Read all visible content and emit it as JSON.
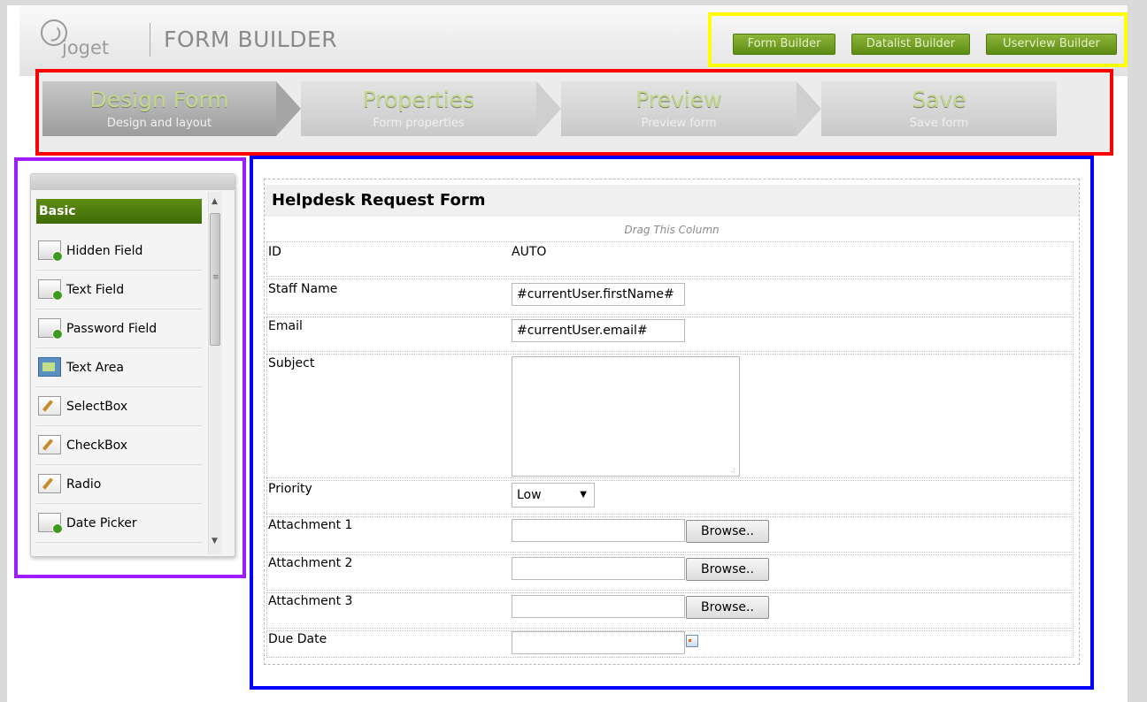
{
  "header": {
    "logo_text": "joget",
    "app_title": "FORM BUILDER",
    "nav": [
      {
        "label": "Form Builder"
      },
      {
        "label": "Datalist Builder"
      },
      {
        "label": "Userview Builder"
      }
    ]
  },
  "wizard": {
    "steps": [
      {
        "label": "Design Form",
        "sub": "Design and layout",
        "active": true
      },
      {
        "label": "Properties",
        "sub": "Form properties",
        "active": false
      },
      {
        "label": "Preview",
        "sub": "Preview form",
        "active": false
      },
      {
        "label": "Save",
        "sub": "Save form",
        "active": false
      }
    ]
  },
  "palette": {
    "category": "Basic",
    "items": [
      {
        "label": "Hidden Field",
        "icon": "field-icon"
      },
      {
        "label": "Text Field",
        "icon": "field-icon"
      },
      {
        "label": "Password Field",
        "icon": "field-icon"
      },
      {
        "label": "Text Area",
        "icon": "text-area-icon"
      },
      {
        "label": "SelectBox",
        "icon": "edit-icon"
      },
      {
        "label": "CheckBox",
        "icon": "edit-icon"
      },
      {
        "label": "Radio",
        "icon": "edit-icon"
      },
      {
        "label": "Date Picker",
        "icon": "field-icon"
      }
    ]
  },
  "form": {
    "title": "Helpdesk Request Form",
    "drag_hint": "Drag This Column",
    "fields": {
      "id": {
        "label": "ID",
        "value": "AUTO"
      },
      "staff_name": {
        "label": "Staff Name",
        "value": "#currentUser.firstName#"
      },
      "email": {
        "label": "Email",
        "value": "#currentUser.email#"
      },
      "subject": {
        "label": "Subject",
        "value": ""
      },
      "priority": {
        "label": "Priority",
        "value": "Low"
      },
      "attachment1": {
        "label": "Attachment 1",
        "button": "Browse.."
      },
      "attachment2": {
        "label": "Attachment 2",
        "button": "Browse.."
      },
      "attachment3": {
        "label": "Attachment 3",
        "button": "Browse.."
      },
      "due_date": {
        "label": "Due Date",
        "value": ""
      }
    }
  },
  "colors": {
    "highlight_nav": "#ffff00",
    "highlight_wizard": "#ff0000",
    "highlight_palette": "#9d1dfc",
    "highlight_canvas": "#0000ff",
    "accent_green": "#5e8d13"
  }
}
